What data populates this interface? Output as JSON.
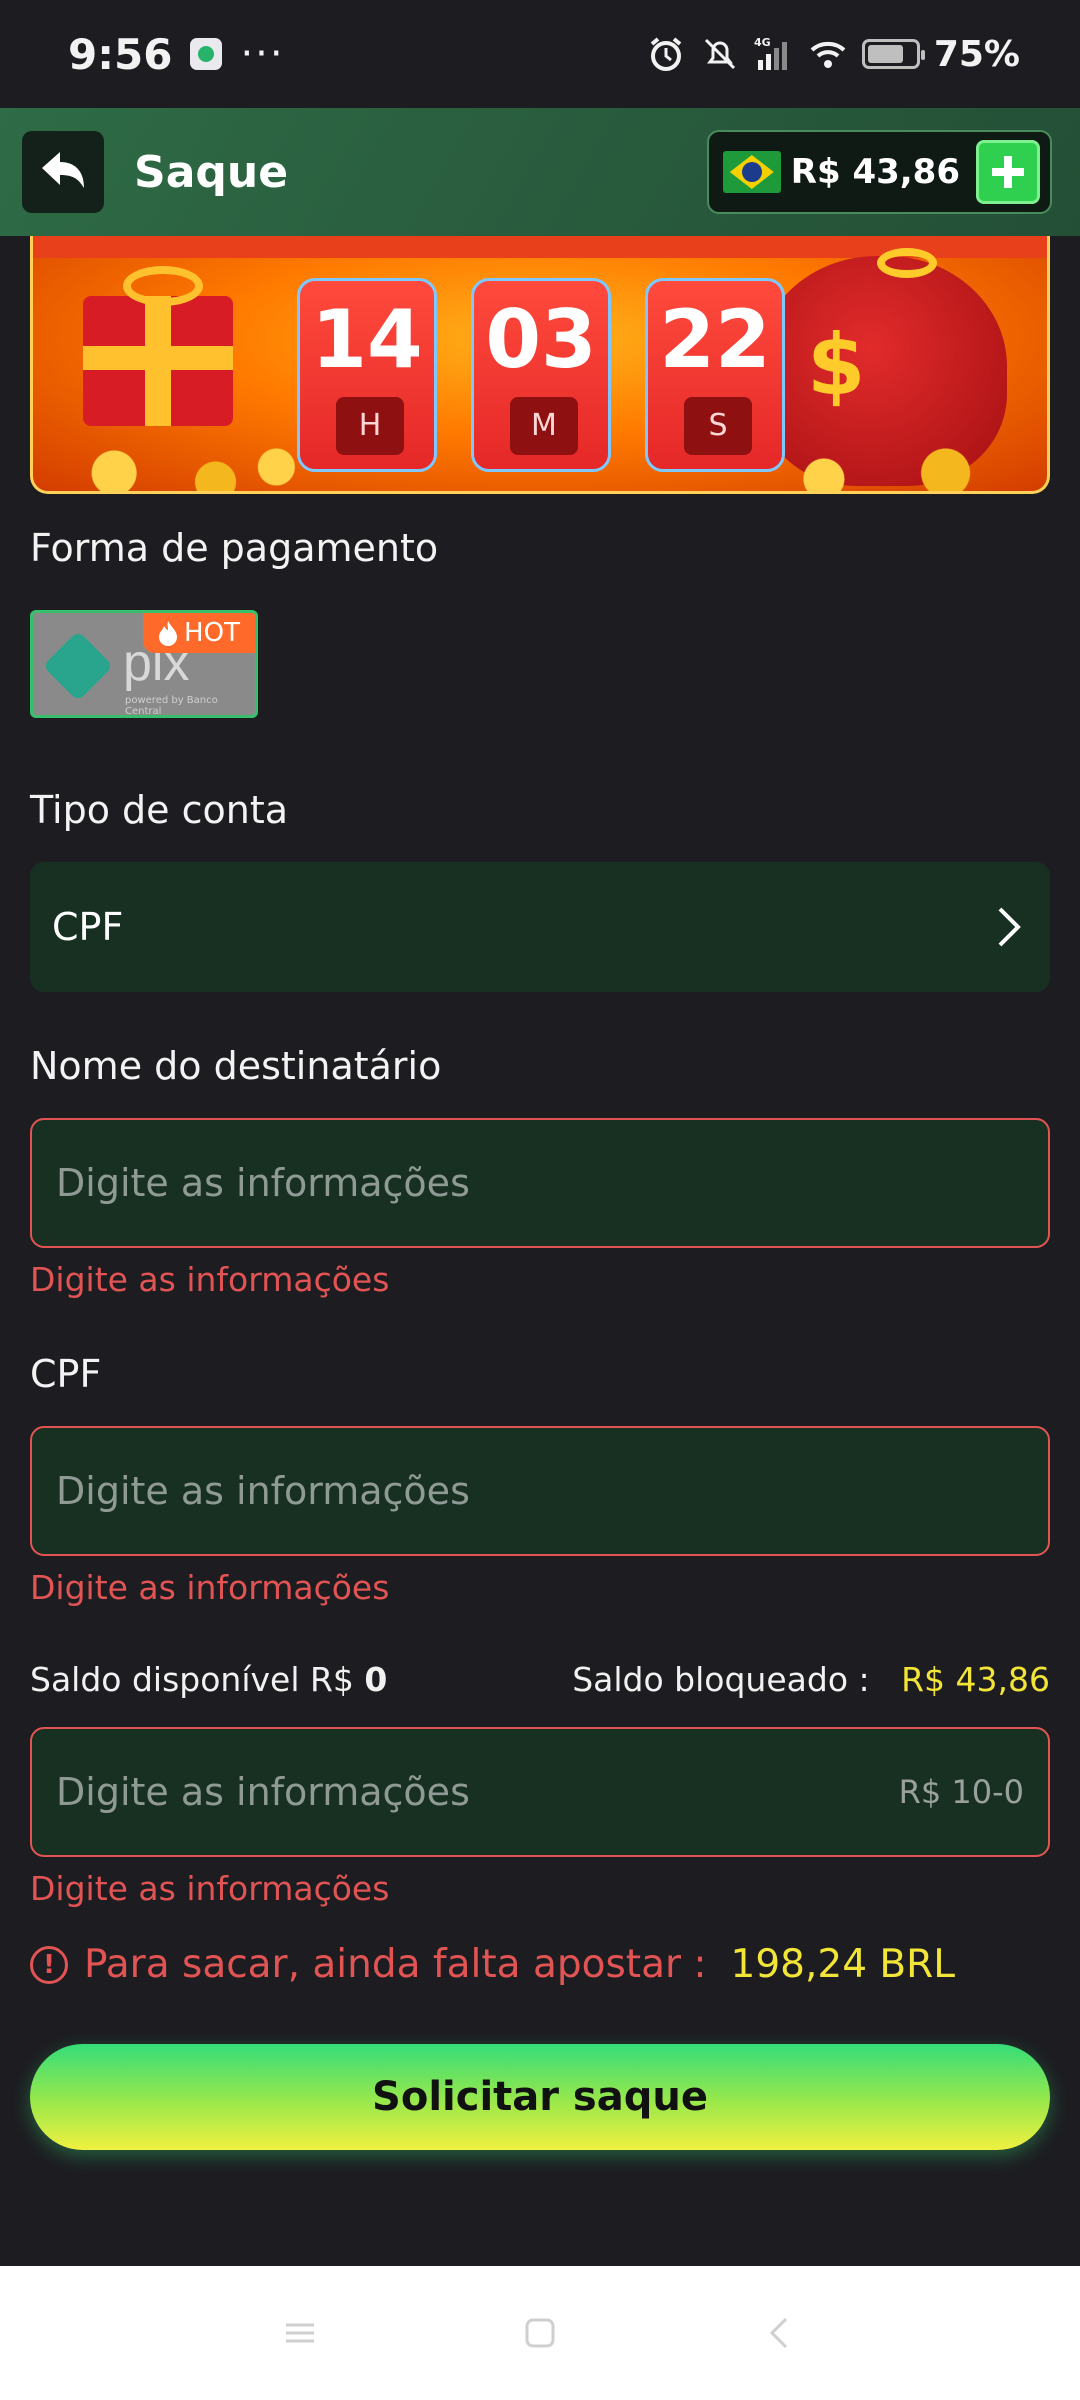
{
  "status_bar": {
    "time": "9:56",
    "dots": "···",
    "network": "4G",
    "battery": "75%",
    "battery_level": 0.75
  },
  "header": {
    "title": "Saque",
    "balance": "R$ 43,86",
    "icons": {
      "back": "back-arrow-icon",
      "flag": "brazil-flag-icon",
      "add": "plus-icon"
    }
  },
  "banner": {
    "timer": [
      {
        "value": "14",
        "unit": "H"
      },
      {
        "value": "03",
        "unit": "M"
      },
      {
        "value": "22",
        "unit": "S"
      }
    ]
  },
  "payment": {
    "label": "Forma de pagamento",
    "method": "pix",
    "method_sub": "powered by Banco Central",
    "badge": "HOT"
  },
  "account_type": {
    "label": "Tipo de conta",
    "value": "CPF"
  },
  "recipient": {
    "label": "Nome do destinatário",
    "placeholder": "Digite as informações",
    "error": "Digite as informações"
  },
  "cpf": {
    "label": "CPF",
    "placeholder": "Digite as informações",
    "error": "Digite as informações"
  },
  "amount": {
    "available_label": "Saldo disponível R$",
    "available_value": "0",
    "blocked_label": "Saldo bloqueado :",
    "blocked_value": "R$ 43,86",
    "placeholder": "Digite as informações",
    "range_hint": "R$ 10-0",
    "error": "Digite as informações"
  },
  "warning": {
    "text": "Para sacar, ainda falta apostar :",
    "amount": "198,24 BRL"
  },
  "submit": {
    "label": "Solicitar saque"
  },
  "colors": {
    "background": "#1d1d21",
    "input_bg": "#173022",
    "error": "#e25454",
    "highlight": "#f2e538",
    "header_green": "#2a5f3f"
  }
}
